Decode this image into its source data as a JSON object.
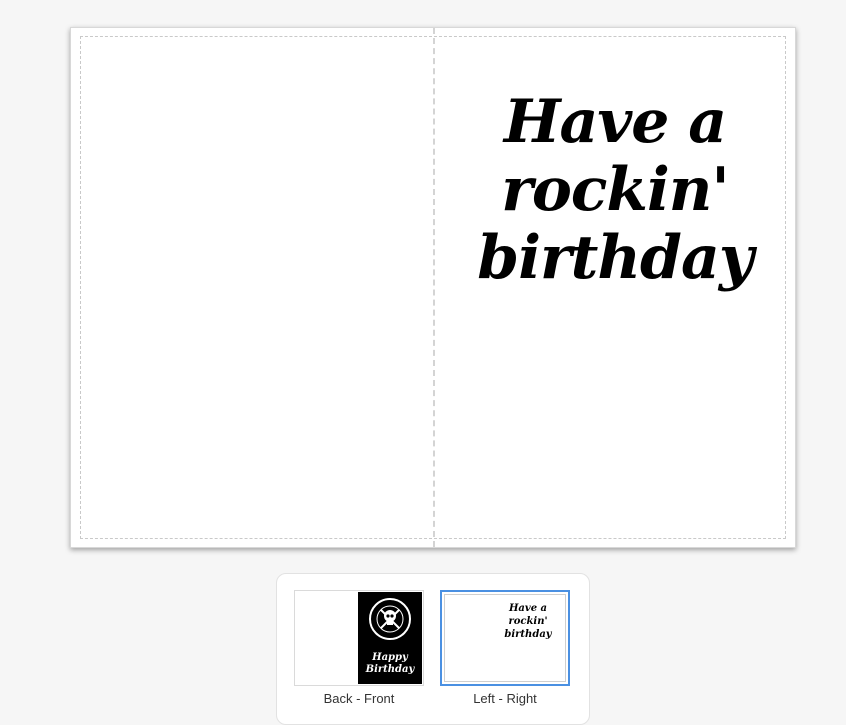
{
  "card": {
    "greeting_lines": [
      "Have a",
      "rockin'",
      "birthday"
    ]
  },
  "pages": [
    {
      "label": "Back - Front",
      "selected": false,
      "front_text_lines": [
        "Happy",
        "Birthday"
      ],
      "emblem": "skull-emblem-icon"
    },
    {
      "label": "Left - Right",
      "selected": true,
      "text_lines": [
        "Have a",
        "rockin'",
        "birthday"
      ]
    }
  ],
  "colors": {
    "selection_accent": "#4a90e2",
    "background": "#f6f6f6",
    "card": "#ffffff"
  }
}
